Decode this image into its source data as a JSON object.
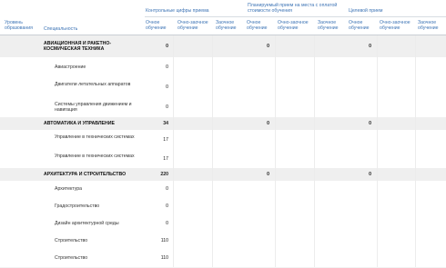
{
  "header": {
    "level": "Уровень образования",
    "specialty": "Специальность",
    "groups": [
      {
        "title": "Контрольные цифры приема"
      },
      {
        "title": "Планируемый прием на места с оплатой стоимости обучения"
      },
      {
        "title": "Целевой прием"
      }
    ],
    "subcols": [
      "Очное обучение",
      "Очно-заочное обучение",
      "Заочное обучение"
    ]
  },
  "rows": [
    {
      "type": "group",
      "name": "АВИАЦИОННАЯ И РАКЕТНО-КОСМИЧЕСКАЯ ТЕХНИКА",
      "kcp": "0",
      "paid": "0",
      "target": "0"
    },
    {
      "type": "item",
      "name": "Авиастроение",
      "kcp": "0"
    },
    {
      "type": "item",
      "name": "Двигатели летательных аппаратов",
      "kcp": "0"
    },
    {
      "type": "item",
      "name": "Системы управления движением и навигация",
      "kcp": "0"
    },
    {
      "type": "group",
      "name": "АВТОМАТИКА И УПРАВЛЕНИЕ",
      "kcp": "34",
      "paid": "0",
      "target": "0"
    },
    {
      "type": "item",
      "name": "Управление в технических системах",
      "kcp": "17"
    },
    {
      "type": "item",
      "name": "Управление в технических системах",
      "kcp": "17"
    },
    {
      "type": "group",
      "name": "АРХИТЕКТУРА И СТРОИТЕЛЬСТВО",
      "kcp": "220",
      "paid": "0",
      "target": "0"
    },
    {
      "type": "item",
      "name": "Архитектура",
      "kcp": "0"
    },
    {
      "type": "item",
      "name": "Градостроительство",
      "kcp": "0"
    },
    {
      "type": "item",
      "name": "Дизайн архитектурной среды",
      "kcp": "0"
    },
    {
      "type": "item",
      "name": "Строительство",
      "kcp": "110"
    },
    {
      "type": "item",
      "name": "Строительство",
      "kcp": "110"
    }
  ]
}
